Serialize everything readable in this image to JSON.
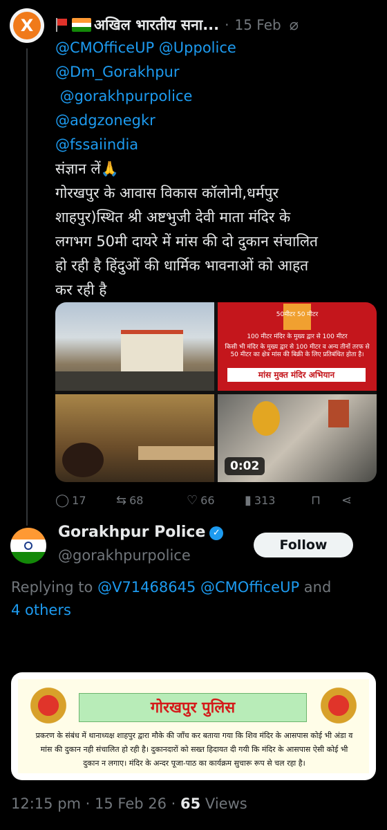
{
  "tweet": {
    "author_name": "अखिल भारतीय सना...",
    "separator": "·",
    "date": "15 Feb",
    "mentions": [
      "@CMOfficeUP @Uppolice",
      "@Dm_Gorakhpur",
      " @gorakhpurpolice",
      "@adgzonegkr",
      "@fssaiindia"
    ],
    "lines": [
      "संज्ञान लें🙏",
      "गोरखपुर के आवास विकास कॉलोनी,धर्मपुर",
      "शाहपुर)स्थित श्री अष्टभुजी देवी माता मंदिर के",
      "लगभग 50मी दायरे में मांस की दो दुकान संचालित",
      "हो रही है हिंदुओं की धार्मिक भावनाओं को आहत",
      "कर रही है"
    ],
    "media": {
      "poster_band_1": "50मीटर          50 मीटर",
      "poster_band_2": "100 मीटर   मंदिर के मुख्य द्वार से   100 मीटर",
      "poster_band_3": "किसी भी मंदिर के मुख्य द्वार से 100 मीटर व अन्य तीनों तरफ से 50 मीटर का क्षेत्र मांस की बिक्री के लिए प्रतिबंधित होता है।",
      "poster_tag": "मांस मुक्त मंदिर अभियान",
      "video_duration": "0:02"
    },
    "actions": {
      "replies": "17",
      "reposts": "68",
      "likes": "66",
      "views": "313"
    }
  },
  "reply": {
    "name": "Gorakhpur Police",
    "handle": "@gorakhpurpolice",
    "follow_label": "Follow",
    "replying_prefix": "Replying to ",
    "replying_mentions": "@V71468645 @CMOfficeUP",
    "replying_and": " and",
    "replying_others": "4 others",
    "notice_title": "गोरखपुर पुलिस",
    "notice_text": "प्रकरण के संबंध में थानाध्यक्ष शाहपुर द्वारा मौके की जाँच कर बताया गया कि शिव मंदिर के आसपास कोई भी अंडा व मांस की दुकान नही संचालित हो रही है। दुकानदारों को सख्त हिदायत दी गयी कि मंदिर के आसपास ऐसी कोई भी दुकान न लगाए। मंदिर के अन्दर पूजा-पाठ का कार्यक्रम सुचारू रूप से चल रहा है।",
    "timestamp": "12:15 pm · 15 Feb 26 · ",
    "views_count": "65",
    "views_label": " Views"
  },
  "colors": {
    "accent": "#1d9bf0",
    "muted": "#71767b",
    "background": "#000000"
  },
  "icons": [
    "x-logo-icon",
    "red-flag-icon",
    "india-flag-icon",
    "grok-icon",
    "reply-icon",
    "repost-icon",
    "like-icon",
    "views-icon",
    "bookmark-icon",
    "share-icon",
    "verified-badge-icon"
  ]
}
